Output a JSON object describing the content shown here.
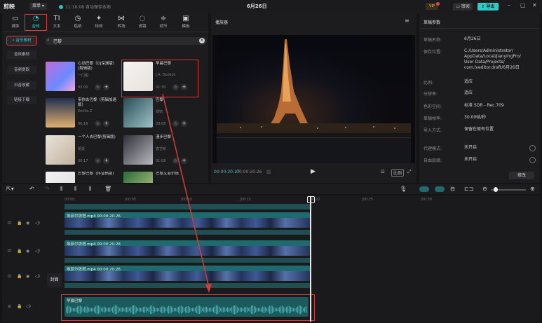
{
  "app": {
    "name": "剪映",
    "menu_label": "菜单",
    "autosave": "11:16:08 自动保存本地",
    "project_title": "6月26日",
    "review_label": "审阅",
    "export_label": "导出",
    "vip_label": "VIP"
  },
  "media_tabs": [
    {
      "icon": "▭",
      "label": "媒体"
    },
    {
      "icon": "◔",
      "label": "音频"
    },
    {
      "icon": "TI",
      "label": "文本"
    },
    {
      "icon": "◷",
      "label": "贴纸"
    },
    {
      "icon": "✦",
      "label": "特效"
    },
    {
      "icon": "⋈",
      "label": "转场"
    },
    {
      "icon": "◌",
      "label": "滤镜"
    },
    {
      "icon": "≑",
      "label": "调节"
    },
    {
      "icon": "▣",
      "label": "模板"
    }
  ],
  "side_nav": [
    "• 音乐素材",
    "音效素材",
    "音频提取",
    "抖音收藏",
    "链接下载"
  ],
  "search": {
    "value": "巴黎"
  },
  "music_cards": [
    {
      "title": "心动巴黎（Dj深渊版）(剪辑版)",
      "sub": "一口甜",
      "dur": "02:00"
    },
    {
      "title": "早晨巴黎",
      "sub": "J.A. Dudson",
      "dur": "01:30"
    },
    {
      "title": "带你去巴黎（剪辑加速版）",
      "sub": "Emilie.Z",
      "dur": "00:18"
    },
    {
      "title": "巴黎",
      "sub": "郑钧",
      "dur": "00:08"
    },
    {
      "title": "一个人去巴黎(剪辑版)",
      "sub": "斑斑",
      "dur": "00:17"
    },
    {
      "title": "漫步巴黎",
      "sub": "唐艺昕",
      "dur": "01:08"
    },
    {
      "title": "巴黎巴黎（抖音热版）",
      "sub": "",
      "dur": ""
    },
    {
      "title": "巴黎艾菲尔塔",
      "sub": "A",
      "dur": ""
    }
  ],
  "player": {
    "title": "播放器",
    "current_time": "00:00:20:17",
    "total_time": "00:00:20:26",
    "ratio_label": "比例"
  },
  "properties": {
    "title": "草稿参数",
    "rows": [
      {
        "label": "草稿名称:",
        "value": "6月26日"
      },
      {
        "label": "保存位置:",
        "value": "C:/Users/Administrator/ AppData/Local/JianyingPro/ User Data/Projects/ com.lveditor.draft/6月26日"
      },
      {
        "label": "比例:",
        "value": "适应"
      },
      {
        "label": "分辨率:",
        "value": "适应"
      },
      {
        "label": "色彩空间:",
        "value": "标准 SDR - Rec.709"
      },
      {
        "label": "草稿帧率:",
        "value": "30.00帧/秒"
      },
      {
        "label": "导入方式:",
        "value": "保留在原有位置"
      },
      {
        "label": "代理模式:",
        "value": "未开启"
      },
      {
        "label": "自由层级:",
        "value": "未开启"
      }
    ],
    "modify_label": "修改"
  },
  "timeline": {
    "ruler": [
      "00:00",
      "|00:05",
      "|00:10",
      "|00:15",
      "|00:20",
      "|00:25",
      "|00:30"
    ],
    "clips": [
      {
        "label": "埃菲尔铁塔.mp4  00:00:20:26"
      },
      {
        "label": "埃菲尔铁塔.mp4  00:00:20:26"
      },
      {
        "label": "埃菲尔铁塔.mp4  00:00:20:26"
      }
    ],
    "cover_label": "封面",
    "audio_label": "早晨巴黎"
  }
}
